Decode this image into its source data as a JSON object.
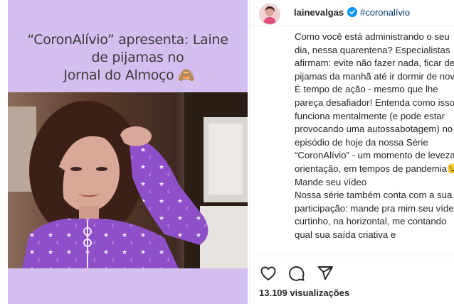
{
  "post": {
    "caption_lines": [
      "“CoronAlívio” apresenta: Laine",
      "de pijamas no",
      "Jornal do Almoço 🙈"
    ]
  },
  "author": {
    "username": "lainevalgas",
    "hashtag": "#coronalívio"
  },
  "description": "Como você está administrando o seu dia, nessa quarentena? Especialistas afirmam: evite não fazer nada, ficar de pijamas da manhã até ir dormir de novo. É tempo de ação - mesmo que lhe pareça desafiador! Entenda como isso funciona mentalmente (e pode estar provocando uma autossabotagem) no episódio de hoje da nossa Série “CoronAlívio” - um momento de leveza e orientação, em tempos de pandemia😉\nMande seu vídeo\nNossa série também conta com a sua participação: mande pra mim seu vídeo, curtinho, na horizontal, me contando qual sua saída criativa e",
  "stats": {
    "views": "13.109 visualizações"
  },
  "colors": {
    "lilac": "#d3c0f0",
    "pajama": "#8f4fc8",
    "link": "#00376b",
    "verified": "#0095f6"
  },
  "icons": [
    "heart-icon",
    "comment-icon",
    "share-icon",
    "verified-badge-icon"
  ]
}
